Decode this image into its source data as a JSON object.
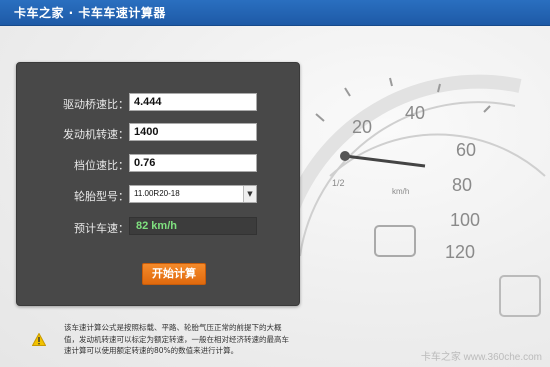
{
  "header": {
    "title": "卡车之家 · 卡车车速计算器"
  },
  "form": {
    "axle_ratio": {
      "label": "驱动桥速比：",
      "value": "4.444"
    },
    "engine_speed": {
      "label": "发动机转速：",
      "value": "1400"
    },
    "gear_ratio": {
      "label": "档位速比：",
      "value": "0.76"
    },
    "tire": {
      "label": "轮胎型号：",
      "selected": "11.00R20-18"
    },
    "estimate": {
      "label": "预计车速：",
      "value": "82 km/h"
    }
  },
  "button": {
    "label": "开始计算"
  },
  "note": {
    "text": "该车速计算公式是按照标载、平路、轮胎气压正常的前提下的大概值，发动机转速可以标定为额定转速，一般在相对经济转速的最高车速计算可以使用额定转速的80%的数值来进行计算。"
  },
  "gauge": {
    "ticks": [
      "20",
      "40",
      "60",
      "80",
      "100",
      "120"
    ],
    "unit": "km/h",
    "fraction": "1/2"
  },
  "watermark": "卡车之家 www.360che.com",
  "colors": {
    "header": "#1e5aa6",
    "panel": "#484848",
    "button": "#f07a1a",
    "result_text": "#7fe07f"
  }
}
